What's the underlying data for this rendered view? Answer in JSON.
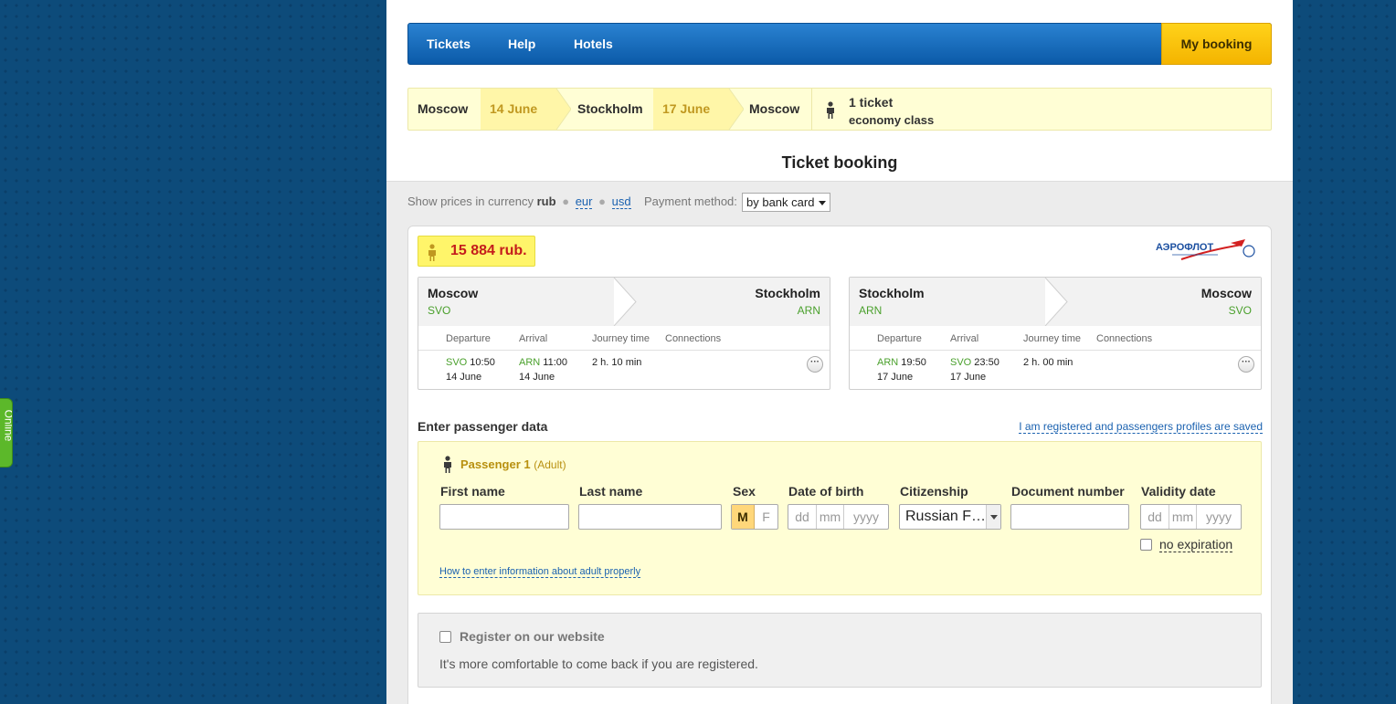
{
  "side_tab": {
    "label": "Online"
  },
  "nav": {
    "items": [
      "Tickets",
      "Help",
      "Hotels"
    ],
    "my_booking": "My booking"
  },
  "route": {
    "from_city": "Moscow",
    "out_date": "14 June",
    "dest_city": "Stockholm",
    "back_date": "17 June",
    "return_city": "Moscow",
    "tickets": "1 ticket",
    "class": "economy class"
  },
  "page_title": "Ticket booking",
  "currency": {
    "prefix": "Show prices in currency",
    "active": "rub",
    "options": [
      "eur",
      "usd"
    ],
    "payment_label": "Payment method:",
    "payment_value": "by bank card"
  },
  "offer": {
    "price": "15 884 rub.",
    "airline_logo": "АЭРОФЛОТ",
    "legs": [
      {
        "from": "Moscow",
        "from_code": "SVO",
        "to": "Stockholm",
        "to_code": "ARN",
        "headers": [
          "Departure",
          "Arrival",
          "Journey time",
          "Connections"
        ],
        "dep_code": "SVO",
        "dep_time": "10:50",
        "dep_date": "14 June",
        "arr_code": "ARN",
        "arr_time": "11:00",
        "arr_date": "14 June",
        "duration": "2 h. 10 min",
        "more": "···"
      },
      {
        "from": "Stockholm",
        "from_code": "ARN",
        "to": "Moscow",
        "to_code": "SVO",
        "headers": [
          "Departure",
          "Arrival",
          "Journey time",
          "Connections"
        ],
        "dep_code": "ARN",
        "dep_time": "19:50",
        "dep_date": "17 June",
        "arr_code": "SVO",
        "arr_time": "23:50",
        "arr_date": "17 June",
        "duration": "2 h. 00 min",
        "more": "···"
      }
    ]
  },
  "passenger": {
    "section_title": "Enter passenger data",
    "registered_link": "I am registered and passengers profiles are saved",
    "title": "Passenger 1",
    "type": "(Adult)",
    "labels": {
      "first_name": "First name",
      "last_name": "Last name",
      "sex": "Sex",
      "dob": "Date of birth",
      "citizenship": "Citizenship",
      "doc_number": "Document number",
      "validity": "Validity date"
    },
    "sex_m": "M",
    "sex_f": "F",
    "dd": "dd",
    "mm": "mm",
    "yyyy": "yyyy",
    "citizenship_value": "Russian F…",
    "no_expiration": "no expiration",
    "howto_link": "How to enter information about adult properly"
  },
  "register": {
    "title": "Register on our website",
    "desc": "It's more comfortable to come back if you are registered."
  }
}
